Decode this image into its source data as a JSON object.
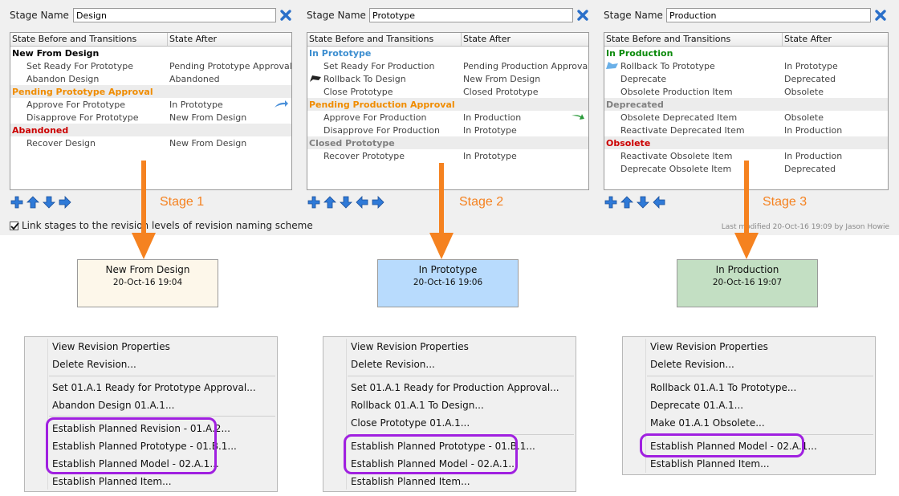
{
  "stage_name_label": "Stage Name",
  "columns": [
    "State Before and Transitions",
    "State After"
  ],
  "link_checkbox_label": "Link stages to the revision levels of revision naming scheme",
  "last_modified": "Last modified 20-Oct-16 19:09 by Jason Howie",
  "colors": {
    "accent_orange": "#f58220",
    "highlight_purple": "#a020e0",
    "state_orange": "#f08c00",
    "state_red": "#cc0000",
    "state_blue": "#3c8ed0",
    "state_green": "#0a8a0a",
    "state_gray": "#808080"
  },
  "stages": [
    {
      "stage_name": "Design",
      "caption": "Stage 1",
      "rows": [
        {
          "type": "state",
          "label": "New From Design",
          "color": "#000000"
        },
        {
          "type": "trans",
          "label": "Set Ready For Prototype",
          "after": "Pending Prototype Approval"
        },
        {
          "type": "trans",
          "label": "Abandon Design",
          "after": "Abandoned"
        },
        {
          "type": "state",
          "label": "Pending Prototype Approval",
          "color": "#f08c00"
        },
        {
          "type": "trans",
          "label": "Approve For Prototype",
          "after": "In Prototype"
        },
        {
          "type": "trans",
          "label": "Disapprove For Prototype",
          "after": "New From Design"
        },
        {
          "type": "state",
          "label": "Abandoned",
          "color": "#cc0000"
        },
        {
          "type": "trans",
          "label": "Recover Design",
          "after": "New From Design"
        }
      ],
      "revision": {
        "state": "New From Design",
        "date": "20-Oct-16 19:04"
      },
      "menu": [
        "View Revision Properties",
        "Delete Revision...",
        "Set 01.A.1 Ready for Prototype Approval...",
        "Abandon Design 01.A.1...",
        "Establish Planned Revision - 01.A.2...",
        "Establish Planned Prototype - 01.B.1...",
        "Establish Planned Model - 02.A.1...",
        "Establish Planned Item..."
      ]
    },
    {
      "stage_name": "Prototype",
      "caption": "Stage 2",
      "rows": [
        {
          "type": "state",
          "label": "In Prototype",
          "color": "#3c8ed0"
        },
        {
          "type": "trans",
          "label": "Set Ready For Production",
          "after": "Pending Production Approval"
        },
        {
          "type": "trans",
          "label": "Rollback To Design",
          "after": "New From Design"
        },
        {
          "type": "trans",
          "label": "Close Prototype",
          "after": "Closed Prototype"
        },
        {
          "type": "state",
          "label": "Pending Production Approval",
          "color": "#f08c00"
        },
        {
          "type": "trans",
          "label": "Approve For Production",
          "after": "In Production"
        },
        {
          "type": "trans",
          "label": "Disapprove For Production",
          "after": "In Prototype"
        },
        {
          "type": "state",
          "label": "Closed Prototype",
          "color": "#808080"
        },
        {
          "type": "trans",
          "label": "Recover Prototype",
          "after": "In Prototype"
        }
      ],
      "revision": {
        "state": "In Prototype",
        "date": "20-Oct-16 19:06"
      },
      "menu": [
        "View Revision Properties",
        "Delete Revision...",
        "Set 01.A.1 Ready for Production Approval...",
        "Rollback 01.A.1 To Design...",
        "Close Prototype 01.A.1...",
        "Establish Planned Prototype - 01.B.1...",
        "Establish Planned Model - 02.A.1...",
        "Establish Planned Item..."
      ]
    },
    {
      "stage_name": "Production",
      "caption": "Stage 3",
      "rows": [
        {
          "type": "state",
          "label": "In Production",
          "color": "#0a8a0a"
        },
        {
          "type": "trans",
          "label": "Rollback To Prototype",
          "after": "In Prototype"
        },
        {
          "type": "trans",
          "label": "Deprecate",
          "after": "Deprecated"
        },
        {
          "type": "trans",
          "label": "Obsolete Production Item",
          "after": "Obsolete"
        },
        {
          "type": "state",
          "label": "Deprecated",
          "color": "#808080"
        },
        {
          "type": "trans",
          "label": "Obsolete Deprecated Item",
          "after": "Obsolete"
        },
        {
          "type": "trans",
          "label": "Reactivate Deprecated Item",
          "after": "In Production"
        },
        {
          "type": "state",
          "label": "Obsolete",
          "color": "#cc0000"
        },
        {
          "type": "trans",
          "label": "Reactivate Obsolete Item",
          "after": "In Production"
        },
        {
          "type": "trans",
          "label": "Deprecate Obsolete Item",
          "after": "Deprecated"
        }
      ],
      "revision": {
        "state": "In Production",
        "date": "20-Oct-16 19:07"
      },
      "menu": [
        "View Revision Properties",
        "Delete Revision...",
        "Rollback 01.A.1 To Prototype...",
        "Deprecate 01.A.1...",
        "Make 01.A.1 Obsolete...",
        "Establish Planned Model - 02.A.1...",
        "Establish Planned Item..."
      ]
    }
  ]
}
